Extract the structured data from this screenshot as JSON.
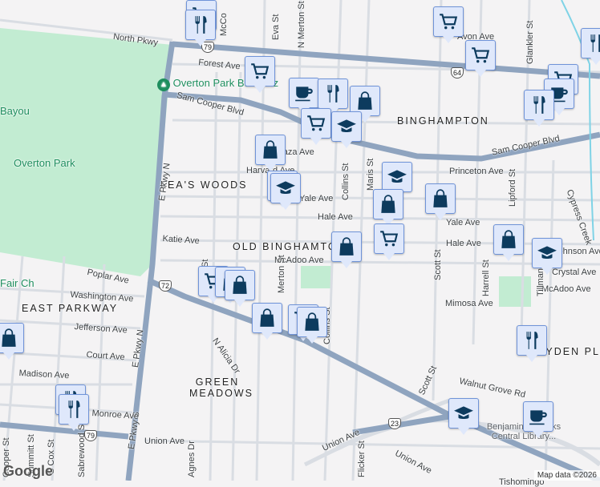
{
  "map": {
    "colors": {
      "background": "#f4f3f4",
      "park": "#c2ecd2",
      "arterial": "#8fa4bf",
      "street": "#d9dde3",
      "marker_fill": "#dfe8fb",
      "marker_icon": "#0d3b5e",
      "park_text": "#1e8e5e"
    },
    "neighborhoods": [
      "LEA'S WOODS",
      "OLD BINGHAMTON",
      "BINGHAMPTON",
      "EAST PARKWAY",
      "GREEN MEADOWS",
      "HAYDEN PL"
    ],
    "parks": [
      "Overton Park",
      "Overton Park Bus Plaz",
      "Bayou",
      "Fair Ch"
    ],
    "streets": [
      "North Pkwy",
      "Forest Ave",
      "Sam Cooper Blvd",
      "Sam Cooper Blvd",
      "E Pkwy N",
      "E Pkwy N",
      "E Pkwy S",
      "Katie Ave",
      "Poplar Ave",
      "Washington Ave",
      "Jefferson Ave",
      "Court Ave",
      "Madison Ave",
      "Monroe Ave",
      "Union Ave",
      "Union Ave",
      "Union Ave",
      "Collins St",
      "Collins St",
      "Maris St",
      "Scott St",
      "Scott St",
      "Lipford St",
      "Glankler St",
      "Princeton Ave",
      "Yale Ave",
      "Yale Ave",
      "Hale Ave",
      "Hale Ave",
      "McAdoo Ave",
      "McAdoo Ave",
      "Crystal Ave",
      "Johnson Ave",
      "Mimosa Ave",
      "Harrell St",
      "Tillman St",
      "Walnut Grove Rd",
      "N Alicia Dr",
      "Eva St",
      "N Merton St",
      "Plaza Ave",
      "Harvard Ave",
      "Merton St",
      "Flicker St",
      "S Cox St",
      "Cooper St",
      "Summitt St",
      "Wilson St",
      "Avon Ave",
      "Tishomingo",
      "Sabrewood St",
      "Agnes Dr",
      "Cypress Creek",
      "McCo"
    ],
    "shields": [
      "79",
      "64",
      "72",
      "79",
      "23"
    ],
    "places": [
      "Benjamin L. Hooks Central Library..."
    ],
    "markers": [
      "cart",
      "restaurant",
      "cart",
      "coffee",
      "restaurant",
      "bag",
      "cart",
      "school",
      "bag",
      "restaurant",
      "school",
      "school",
      "bag",
      "bag",
      "cart",
      "bag",
      "bag",
      "school",
      "cart",
      "cart",
      "restaurant",
      "cart",
      "coffee",
      "restaurant",
      "cart",
      "bag",
      "bag",
      "bag",
      "cart",
      "bag",
      "bag",
      "restaurant",
      "restaurant",
      "restaurant",
      "school",
      "coffee",
      "restaurant"
    ]
  },
  "attribution": {
    "logo": "Google",
    "text": "Map data ©2026"
  }
}
